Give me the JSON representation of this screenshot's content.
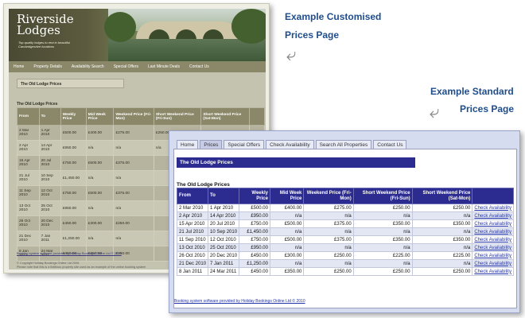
{
  "captions": {
    "customised_line1": "Example Customised",
    "customised_line2": "Prices Page",
    "standard_line1": "Example Standard",
    "standard_line2": "Prices Page"
  },
  "custom_site": {
    "logo_line1": "Riverside",
    "logo_line2": "Lodges",
    "tagline": "Top quality lodges to rent in beautiful Cambridgeshire locations",
    "nav": [
      "Home",
      "Property Details",
      "Availability Search",
      "Special Offers",
      "Last Minute Deals",
      "Contact Us"
    ],
    "page_box": "The Old Lodge Prices",
    "subtitle": "The Old Lodge Prices",
    "headers": [
      "From",
      "To",
      "Weekly Price",
      "Mid Week Price",
      "Weekend Price (Fri-Mon)",
      "Short Weekend Price (Fri-Sun)",
      "Short Weekend Price (Sat-Mon)",
      ""
    ],
    "rows": [
      [
        "2 Mar 2010",
        "1 Apr 2010",
        "£500.00",
        "£400.00",
        "£275.00",
        "£250.00",
        "",
        "Check"
      ],
      [
        "2 Apr 2010",
        "14 Apr 2010",
        "£950.00",
        "n/a",
        "n/a",
        "n/a",
        "",
        ""
      ],
      [
        "15 Apr 2010",
        "20 Jul 2010",
        "£750.00",
        "£500.00",
        "£375.00",
        "",
        "",
        ""
      ],
      [
        "21 Jul 2010",
        "10 Sep 2010",
        "£1,450.00",
        "n/a",
        "n/a",
        "",
        "",
        ""
      ],
      [
        "11 Sep 2010",
        "12 Oct 2010",
        "£750.00",
        "£500.00",
        "£375.00",
        "",
        "",
        ""
      ],
      [
        "13 Oct 2010",
        "25 Oct 2010",
        "£950.00",
        "n/a",
        "n/a",
        "",
        "",
        ""
      ],
      [
        "26 Oct 2010",
        "20 Dec 2010",
        "£450.00",
        "£300.00",
        "£250.00",
        "",
        "",
        ""
      ],
      [
        "21 Dec 2010",
        "7 Jan 2011",
        "£1,250.00",
        "n/a",
        "n/a",
        "",
        "",
        ""
      ],
      [
        "8 Jan 2011",
        "24 Mar 2011",
        "£450.00",
        "£350.00",
        "£250.00",
        "",
        "",
        ""
      ]
    ],
    "footer": "Booking system software provided by Holiday Bookings Online Ltd © 2010",
    "copyright": "© Copyright Holiday Bookings Online Ltd 2006",
    "note": "Please note that this is a fictitious property site used as an example of the online booking system"
  },
  "standard_site": {
    "tabs": [
      "Home",
      "Prices",
      "Special Offers",
      "Check Availability",
      "Search All Properties",
      "Contact Us"
    ],
    "active_tab": "Prices",
    "title_bar": "The Old Lodge Prices",
    "subtitle": "The Old Lodge Prices",
    "headers": [
      "From",
      "To",
      "Weekly Price",
      "Mid Week Price",
      "Weekend Price (Fri-Mon)",
      "Short Weekend Price (Fri-Sun)",
      "Short Weekend Price (Sat-Mon)",
      ""
    ],
    "rows": [
      [
        "2 Mar 2010",
        "1 Apr 2010",
        "£500.00",
        "£400.00",
        "£275.00",
        "£250.00",
        "£250.00",
        "Check Availability"
      ],
      [
        "2 Apr 2010",
        "14 Apr 2010",
        "£950.00",
        "n/a",
        "n/a",
        "n/a",
        "n/a",
        "Check Availability"
      ],
      [
        "15 Apr 2010",
        "20 Jul 2010",
        "£750.00",
        "£500.00",
        "£375.00",
        "£350.00",
        "£350.00",
        "Check Availability"
      ],
      [
        "21 Jul 2010",
        "10 Sep 2010",
        "£1,450.00",
        "n/a",
        "n/a",
        "n/a",
        "n/a",
        "Check Availability"
      ],
      [
        "11 Sep 2010",
        "12 Oct 2010",
        "£750.00",
        "£500.00",
        "£375.00",
        "£350.00",
        "£350.00",
        "Check Availability"
      ],
      [
        "13 Oct 2010",
        "25 Oct 2010",
        "£950.00",
        "n/a",
        "n/a",
        "n/a",
        "n/a",
        "Check Availability"
      ],
      [
        "26 Oct 2010",
        "20 Dec 2010",
        "£450.00",
        "£300.00",
        "£250.00",
        "£225.00",
        "£225.00",
        "Check Availability"
      ],
      [
        "21 Dec 2010",
        "7 Jan 2011",
        "£1,250.00",
        "n/a",
        "n/a",
        "n/a",
        "n/a",
        "Check Availability"
      ],
      [
        "8 Jan 2011",
        "24 Mar 2011",
        "£450.00",
        "£350.00",
        "£250.00",
        "£250.00",
        "£250.00",
        "Check Availability"
      ]
    ],
    "footer": "Booking system software provided by Holiday Bookings Online Ltd © 2010"
  }
}
